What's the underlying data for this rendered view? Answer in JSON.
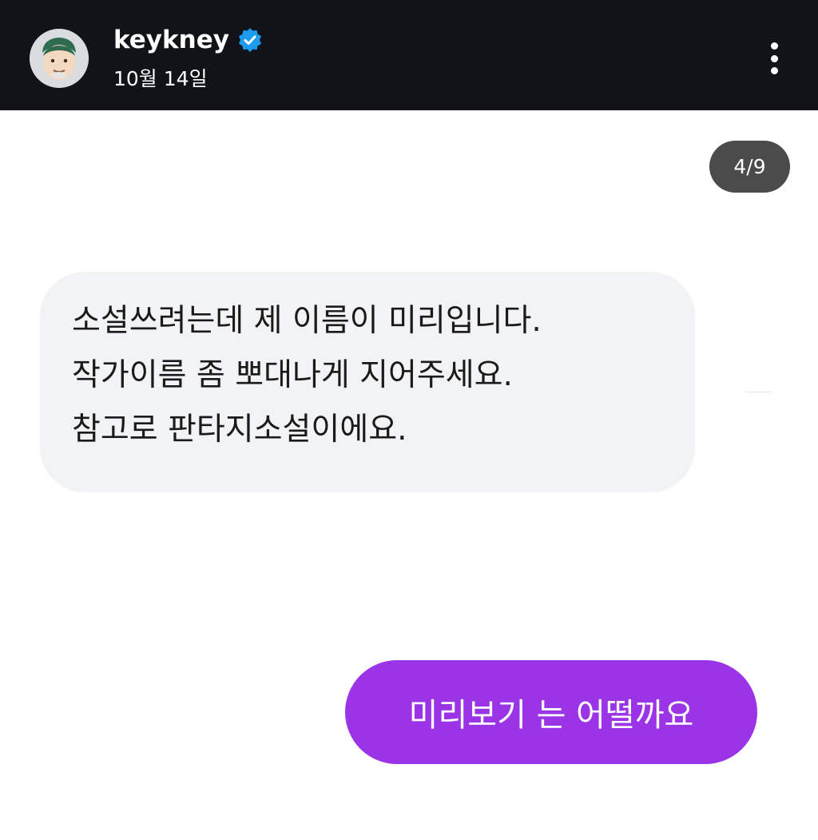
{
  "header": {
    "username": "keykney",
    "date": "10월 14일",
    "verified": true,
    "avatar_icon": "cartoon-face-avatar",
    "more_icon": "vertical-ellipsis-icon"
  },
  "page_counter": "4/9",
  "messages": {
    "received": {
      "lines": [
        "소설쓰려는데 제 이름이 미리입니다.",
        "작가이름 좀 뽀대나게 지어주세요.",
        "참고로 판타지소설이에요."
      ]
    },
    "sent": {
      "text": "미리보기 는 어떨까요"
    }
  },
  "colors": {
    "header_bg": "#101318",
    "received_bubble": "#f1f3f5",
    "sent_bubble": "#9b34e6",
    "verified_badge": "#1d9bf0",
    "counter_bg": "#4b4b4b"
  }
}
